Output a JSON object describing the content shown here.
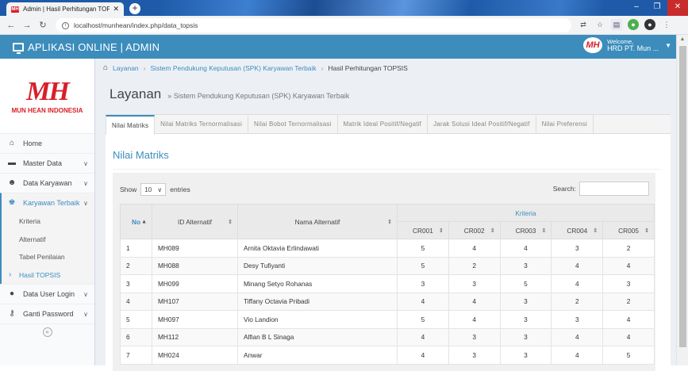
{
  "browser": {
    "tab_title": "Admin | Hasil Perhitungan TOPSIS",
    "favicon": "MH",
    "url": "localhost/munhean/index.php/data_topsis"
  },
  "header": {
    "title": "APLIKASI ONLINE | ADMIN",
    "welcome": "Welcome,",
    "user": "HRD PT. Mun ...",
    "logo": "MH"
  },
  "sidebar": {
    "logo_mark": "MH",
    "logo_name": "MUN HEAN INDONESIA",
    "items": [
      {
        "label": "Home",
        "icon": "home-icon"
      },
      {
        "label": "Master Data",
        "icon": "folder-icon"
      },
      {
        "label": "Data Karyawan",
        "icon": "users-icon"
      },
      {
        "label": "Karyawan Terbaik",
        "icon": "trophy-icon"
      }
    ],
    "subitems": [
      "Kriteria",
      "Alternatif",
      "Tabel Penilaian",
      "Hasil TOPSIS"
    ],
    "bottom_items": [
      {
        "label": "Data User Login",
        "icon": "user-icon"
      },
      {
        "label": "Ganti Password",
        "icon": "key-icon"
      }
    ]
  },
  "breadcrumb": {
    "items": [
      "Layanan",
      "Sistem Pendukung Keputusan (SPK) Karyawan Terbaik",
      "Hasil Perhitungan TOPSIS"
    ]
  },
  "page": {
    "title": "Layanan",
    "subtitle": "» Sistem Pendukung Keputusan (SPK) Karyawan Terbaik"
  },
  "tabs": [
    "Nilai Matriks",
    "Nilai Matriks Ternormalisasi",
    "Nilai Bobot Ternormalisasi",
    "Matrik Ideal Positif/Negatif",
    "Jarak Solusi Ideal Positif/Negatif",
    "Nilai Preferensi"
  ],
  "panel": {
    "heading": "Nilai Matriks"
  },
  "table_controls": {
    "show": "Show",
    "entries_value": "10",
    "entries": "entries",
    "search": "Search:"
  },
  "table": {
    "headers": {
      "no": "No",
      "id": "ID Alternatif",
      "name": "Nama Alternatif",
      "kriteria": "Kriteria"
    },
    "criteria": [
      "CR001",
      "CR002",
      "CR003",
      "CR004",
      "CR005"
    ],
    "rows": [
      [
        "1",
        "MH089",
        "Arnita Oktavia Erlindawati",
        "5",
        "4",
        "4",
        "3",
        "2"
      ],
      [
        "2",
        "MH088",
        "Desy Tufiyanti",
        "5",
        "2",
        "3",
        "4",
        "4"
      ],
      [
        "3",
        "MH099",
        "Minang Setyo Rohanas",
        "3",
        "3",
        "5",
        "4",
        "3"
      ],
      [
        "4",
        "MH107",
        "Tiffany Octavia Pribadi",
        "4",
        "4",
        "3",
        "2",
        "2"
      ],
      [
        "5",
        "MH097",
        "Vio Landion",
        "5",
        "4",
        "3",
        "3",
        "4"
      ],
      [
        "6",
        "MH112",
        "Alfian B L Sinaga",
        "4",
        "3",
        "3",
        "4",
        "4"
      ],
      [
        "7",
        "MH024",
        "Anwar",
        "4",
        "3",
        "3",
        "4",
        "5"
      ]
    ]
  }
}
